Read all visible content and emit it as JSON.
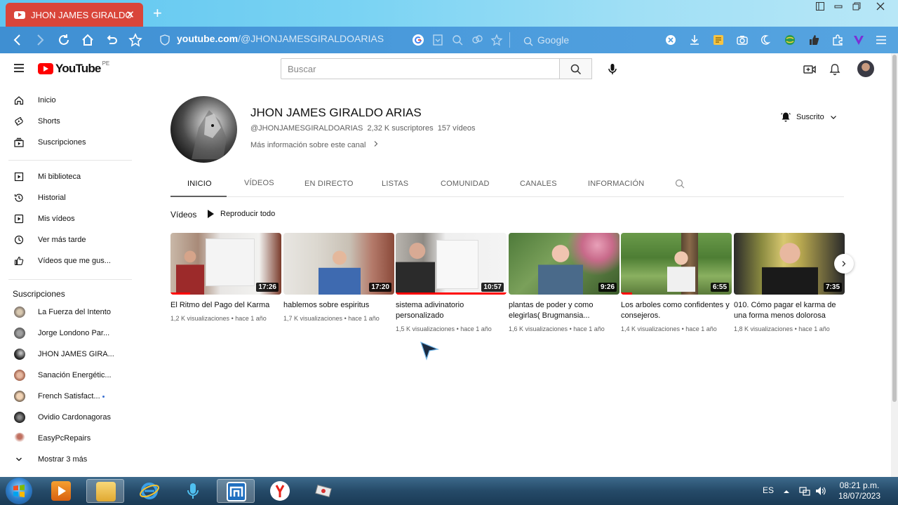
{
  "browser": {
    "tab_title": "JHON JAMES GIRALDO",
    "new_tab_glyph": "+",
    "url_host": "youtube.com",
    "url_path": "/@JHONJAMESGIRALDOARIAS",
    "search_placeholder": "Google",
    "close_tab_glyph": "✕"
  },
  "youtube": {
    "logo_text": "YouTube",
    "country_code": "PE",
    "search_placeholder": "Buscar"
  },
  "sidebar": {
    "items": [
      {
        "label": "Inicio",
        "icon": "home-icon"
      },
      {
        "label": "Shorts",
        "icon": "shorts-icon"
      },
      {
        "label": "Suscripciones",
        "icon": "subscriptions-icon"
      },
      {
        "label": "Mi biblioteca",
        "icon": "library-icon"
      },
      {
        "label": "Historial",
        "icon": "history-icon"
      },
      {
        "label": "Mis vídeos",
        "icon": "my-videos-icon"
      },
      {
        "label": "Ver más tarde",
        "icon": "watch-later-icon"
      },
      {
        "label": "Vídeos que me gus...",
        "icon": "liked-videos-icon"
      }
    ],
    "subscriptions_title": "Suscripciones",
    "subscriptions": [
      {
        "label": "La Fuerza del Intento"
      },
      {
        "label": "Jorge Londono Par..."
      },
      {
        "label": "JHON JAMES GIRA..."
      },
      {
        "label": "Sanación Energétic..."
      },
      {
        "label": "French Satisfact..."
      },
      {
        "label": "Ovidio Cardonagoras"
      },
      {
        "label": "EasyPcRepairs"
      }
    ],
    "show_more": "Mostrar 3 más"
  },
  "channel": {
    "name": "JHON JAMES GIRALDO ARIAS",
    "handle": "@JHONJAMESGIRALDOARIAS",
    "subscribers": "2,32 K suscriptores",
    "video_count": "157 vídeos",
    "more_info": "Más información sobre este canal",
    "subscribe_state": "Suscrito"
  },
  "tabs": [
    "INICIO",
    "VÍDEOS",
    "EN DIRECTO",
    "LISTAS",
    "COMUNIDAD",
    "CANALES",
    "INFORMACIÓN"
  ],
  "section": {
    "title": "Vídeos",
    "play_all": "Reproducir todo"
  },
  "videos": [
    {
      "title": "El Ritmo del Pago del Karma",
      "duration": "17:26",
      "views": "1,2 K visualizaciones",
      "age": "hace 1 año",
      "progress": 0.18
    },
    {
      "title": "hablemos sobre espiritus",
      "duration": "17:20",
      "views": "1,7 K visualizaciones",
      "age": "hace 1 año",
      "progress": 0
    },
    {
      "title": "sistema adivinatorio personalizado",
      "duration": "10:57",
      "views": "1,5 K visualizaciones",
      "age": "hace 1 año",
      "progress": 1.0
    },
    {
      "title": "plantas de poder y como elegirlas( Brugmansia...",
      "duration": "9:26",
      "views": "1,6 K visualizaciones",
      "age": "hace 1 año",
      "progress": 0
    },
    {
      "title": "Los arboles como confidentes y consejeros.",
      "duration": "6:55",
      "views": "1,4 K visualizaciones",
      "age": "hace 1 año",
      "progress": 0.1
    },
    {
      "title": "010. Cómo pagar el karma de una forma menos dolorosa",
      "duration": "7:35",
      "views": "1,8 K visualizaciones",
      "age": "hace 1 año",
      "progress": 0
    }
  ],
  "meta_separator": "•",
  "taskbar": {
    "language": "ES",
    "time": "08:21 p.m.",
    "date": "18/07/2023"
  }
}
